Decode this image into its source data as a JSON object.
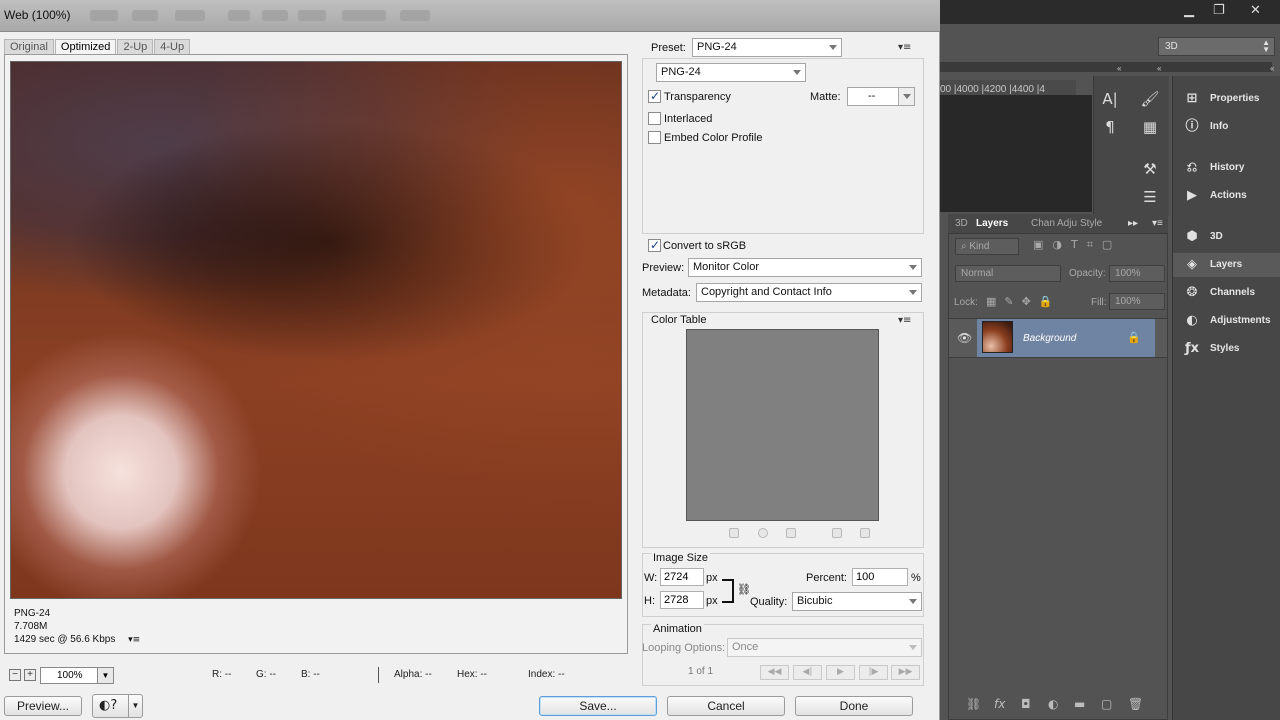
{
  "window": {
    "title": "Web (100%)"
  },
  "view_tabs": [
    "Original",
    "Optimized",
    "2-Up",
    "4-Up"
  ],
  "active_tab": "Optimized",
  "image_info": {
    "format": "PNG-24",
    "size": "7.708M",
    "time": "1429 sec @ 56.6 Kbps"
  },
  "zoom": {
    "value": "100%"
  },
  "readouts": {
    "r": "R: --",
    "g": "G: --",
    "b": "B: --",
    "alpha": "Alpha: --",
    "hex": "Hex: --",
    "index": "Index: --"
  },
  "buttons": {
    "preview": "Preview...",
    "save": "Save...",
    "cancel": "Cancel",
    "done": "Done"
  },
  "settings": {
    "preset_label": "Preset:",
    "preset_value": "PNG-24",
    "format_value": "PNG-24",
    "transparency": {
      "label": "Transparency",
      "checked": true
    },
    "matte_label": "Matte:",
    "matte_value": "--",
    "interlaced": {
      "label": "Interlaced",
      "checked": false
    },
    "embed_profile": {
      "label": "Embed Color Profile",
      "checked": false
    },
    "convert_srgb": {
      "label": "Convert to sRGB",
      "checked": true
    },
    "preview_label": "Preview:",
    "preview_value": "Monitor Color",
    "metadata_label": "Metadata:",
    "metadata_value": "Copyright and Contact Info"
  },
  "color_table": {
    "title": "Color Table",
    "swatch_color": "#808080"
  },
  "image_size": {
    "title": "Image Size",
    "w_label": "W:",
    "w_value": "2724",
    "w_unit": "px",
    "h_label": "H:",
    "h_value": "2728",
    "h_unit": "px",
    "percent_label": "Percent:",
    "percent_value": "100",
    "percent_unit": "%",
    "quality_label": "Quality:",
    "quality_value": "Bicubic"
  },
  "animation": {
    "title": "Animation",
    "looping_label": "Looping Options:",
    "looping_value": "Once",
    "frame_counter": "1 of 1"
  },
  "ps": {
    "workspace": "3D",
    "ruler": "00  |4000  |4200  |4400  |4",
    "panels": [
      {
        "name": "Properties",
        "icon": "properties-icon"
      },
      {
        "name": "Info",
        "icon": "info-icon"
      },
      {
        "name": "History",
        "icon": "history-icon"
      },
      {
        "name": "Actions",
        "icon": "actions-icon"
      },
      {
        "name": "3D",
        "icon": "cube-icon"
      },
      {
        "name": "Layers",
        "icon": "layers-icon"
      },
      {
        "name": "Channels",
        "icon": "channels-icon"
      },
      {
        "name": "Adjustments",
        "icon": "adjustments-icon"
      },
      {
        "name": "Styles",
        "icon": "styles-icon"
      }
    ],
    "layer_tabs": [
      "3D",
      "Layers",
      "Chan",
      "Adju",
      "Style"
    ],
    "kind_label": "Kind",
    "blend_mode": "Normal",
    "opacity_label": "Opacity:",
    "opacity_value": "100%",
    "lock_label": "Lock:",
    "fill_label": "Fill:",
    "fill_value": "100%",
    "layer_name": "Background"
  }
}
